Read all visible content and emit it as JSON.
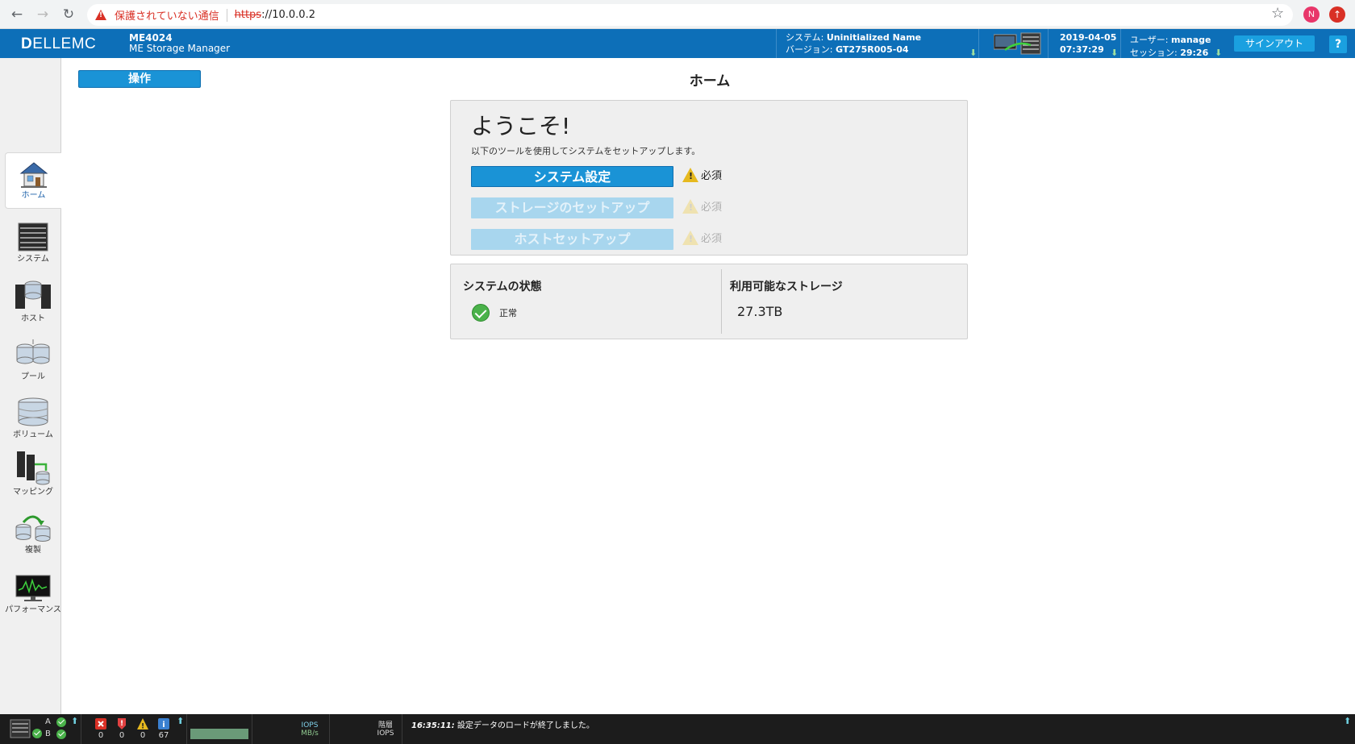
{
  "browser": {
    "insecure_text": "保護されていない通信",
    "url_protocol": "https",
    "url_rest": "://10.0.0.2",
    "profile_initial": "N"
  },
  "header": {
    "brand_bold": "D",
    "brand_rest": "ELLEMC",
    "model": "ME4024",
    "product": "ME Storage Manager",
    "system_label": "システム: ",
    "system_name": "Uninitialized Name",
    "version_label": "バージョン: ",
    "version": "GT275R005-04",
    "date": "2019-04-05",
    "time": "07:37:29",
    "user_label": "ユーザー: ",
    "user": "manage",
    "session_label": "セッション: ",
    "session": "29:26",
    "signout_label": "サインアウト",
    "help_label": "?"
  },
  "sidebar": {
    "items": [
      {
        "label": "ホーム"
      },
      {
        "label": "システム"
      },
      {
        "label": "ホスト"
      },
      {
        "label": "プール"
      },
      {
        "label": "ボリューム"
      },
      {
        "label": "マッピング"
      },
      {
        "label": "複製"
      },
      {
        "label": "パフォーマンス"
      }
    ]
  },
  "main": {
    "ops_label": "操作",
    "page_title": "ホーム",
    "welcome": {
      "title": "ようこそ!",
      "subtitle": "以下のツールを使用してシステムをセットアップします。",
      "steps": [
        {
          "label": "システム設定",
          "status": "必須"
        },
        {
          "label": "ストレージのセットアップ",
          "status": "必須"
        },
        {
          "label": "ホストセットアップ",
          "status": "必須"
        }
      ]
    },
    "system_status": {
      "heading": "システムの状態",
      "value": "正常"
    },
    "storage": {
      "heading": "利用可能なストレージ",
      "value": "27.3TB"
    }
  },
  "footer": {
    "ctrl_a": "A",
    "ctrl_b": "B",
    "alerts": {
      "critical": "0",
      "error": "0",
      "warning": "0",
      "info": "67"
    },
    "iops_label": "IOPS",
    "mbs_label": "MB/s",
    "tier_label": "階層",
    "tier_iops_label": "IOPS",
    "msg_time": "16:35:11:",
    "msg_text": " 設定データのロードが終了しました。"
  },
  "colors": {
    "header_blue": "#0d6fb8",
    "button_blue": "#1a93d6",
    "disabled_blue": "#a8d6ee",
    "warning_yellow": "#e6b91e",
    "ok_green": "#4ab24a",
    "insecure_red": "#d93025"
  }
}
